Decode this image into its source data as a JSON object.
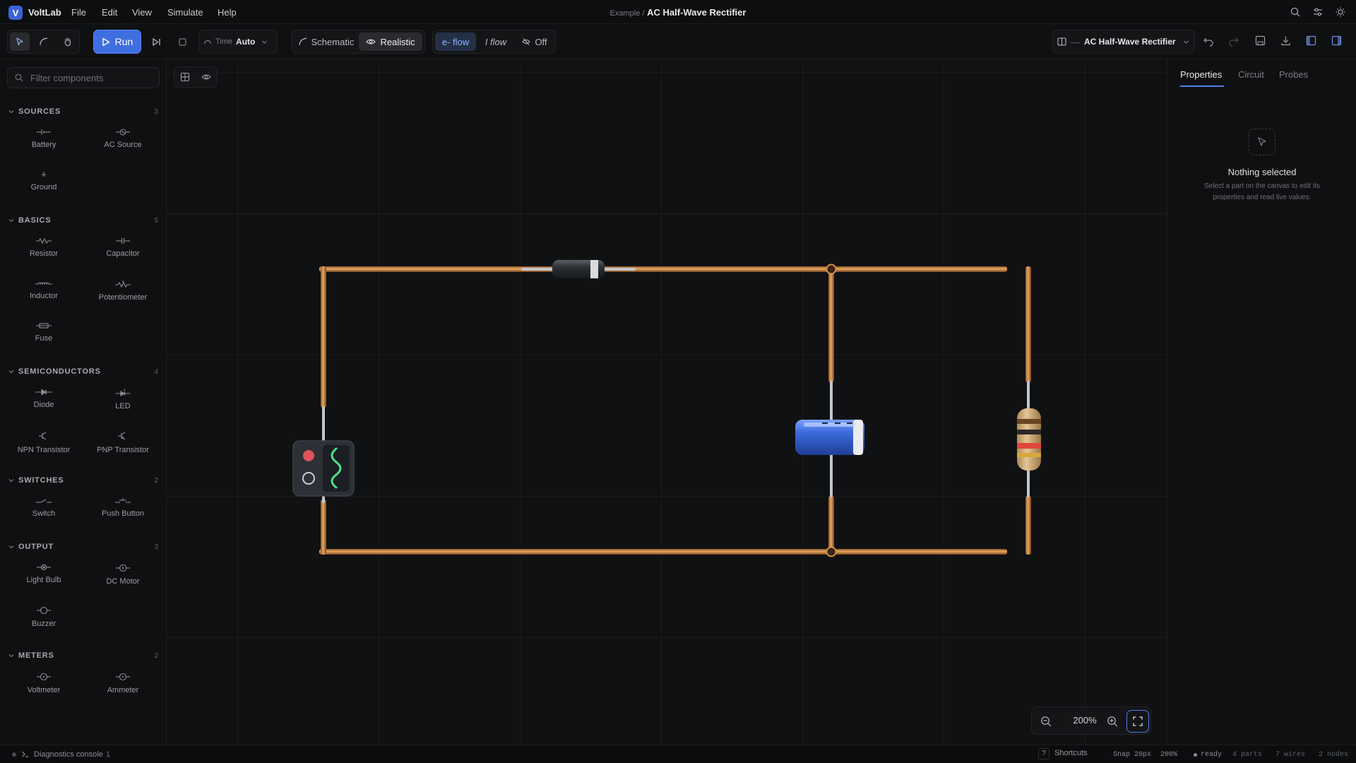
{
  "app": {
    "logo_letter": "V",
    "name": "VoltLab"
  },
  "menu": [
    "File",
    "Edit",
    "View",
    "Simulate",
    "Help"
  ],
  "breadcrumb": {
    "parent": "Example /",
    "document": "AC Half-Wave Rectifier"
  },
  "toolbar": {
    "run_label": "Run",
    "time_label": "Time",
    "time_value": "Auto",
    "view_modes": [
      "Schematic",
      "Realistic"
    ],
    "active_view": "Realistic",
    "flow_modes": [
      "e- flow",
      "I flow",
      "Off"
    ],
    "active_flow": "e- flow",
    "project_title": "AC Half-Wave Rectifier"
  },
  "sidebar": {
    "filter_placeholder": "Filter components",
    "sections": [
      {
        "title": "SOURCES",
        "count": "3",
        "items": [
          "Battery",
          "AC Source",
          "Ground"
        ]
      },
      {
        "title": "BASICS",
        "count": "5",
        "items": [
          "Resistor",
          "Capacitor",
          "Inductor",
          "Potentiometer",
          "Fuse"
        ]
      },
      {
        "title": "SEMICONDUCTORS",
        "count": "4",
        "items": [
          "Diode",
          "LED",
          "NPN Transistor",
          "PNP Transistor"
        ]
      },
      {
        "title": "SWITCHES",
        "count": "2",
        "items": [
          "Switch",
          "Push Button"
        ]
      },
      {
        "title": "OUTPUT",
        "count": "3",
        "items": [
          "Light Bulb",
          "DC Motor",
          "Buzzer"
        ]
      },
      {
        "title": "METERS",
        "count": "2",
        "items": [
          "Voltmeter",
          "Ammeter"
        ]
      }
    ]
  },
  "canvas": {
    "zoom": "200%"
  },
  "right_panel": {
    "tabs": [
      "Properties",
      "Circuit",
      "Probes"
    ],
    "active_tab": "Properties",
    "empty_title": "Nothing selected",
    "empty_desc": "Select a part on the canvas to edit its properties and read live values."
  },
  "status": {
    "console_label": "Diagnostics console",
    "console_count": "1",
    "shortcuts_key": "?",
    "shortcuts_label": "Shortcuts",
    "snap": "Snap 20px",
    "zoom": "200%",
    "state": "ready",
    "parts": "4 parts",
    "wires": "7 wires",
    "nodes": "2 nodes"
  },
  "colors": {
    "accent": "#3f6ee0",
    "wire": "#d9914c",
    "canvas": "#101112",
    "panel": "#0f1011"
  }
}
